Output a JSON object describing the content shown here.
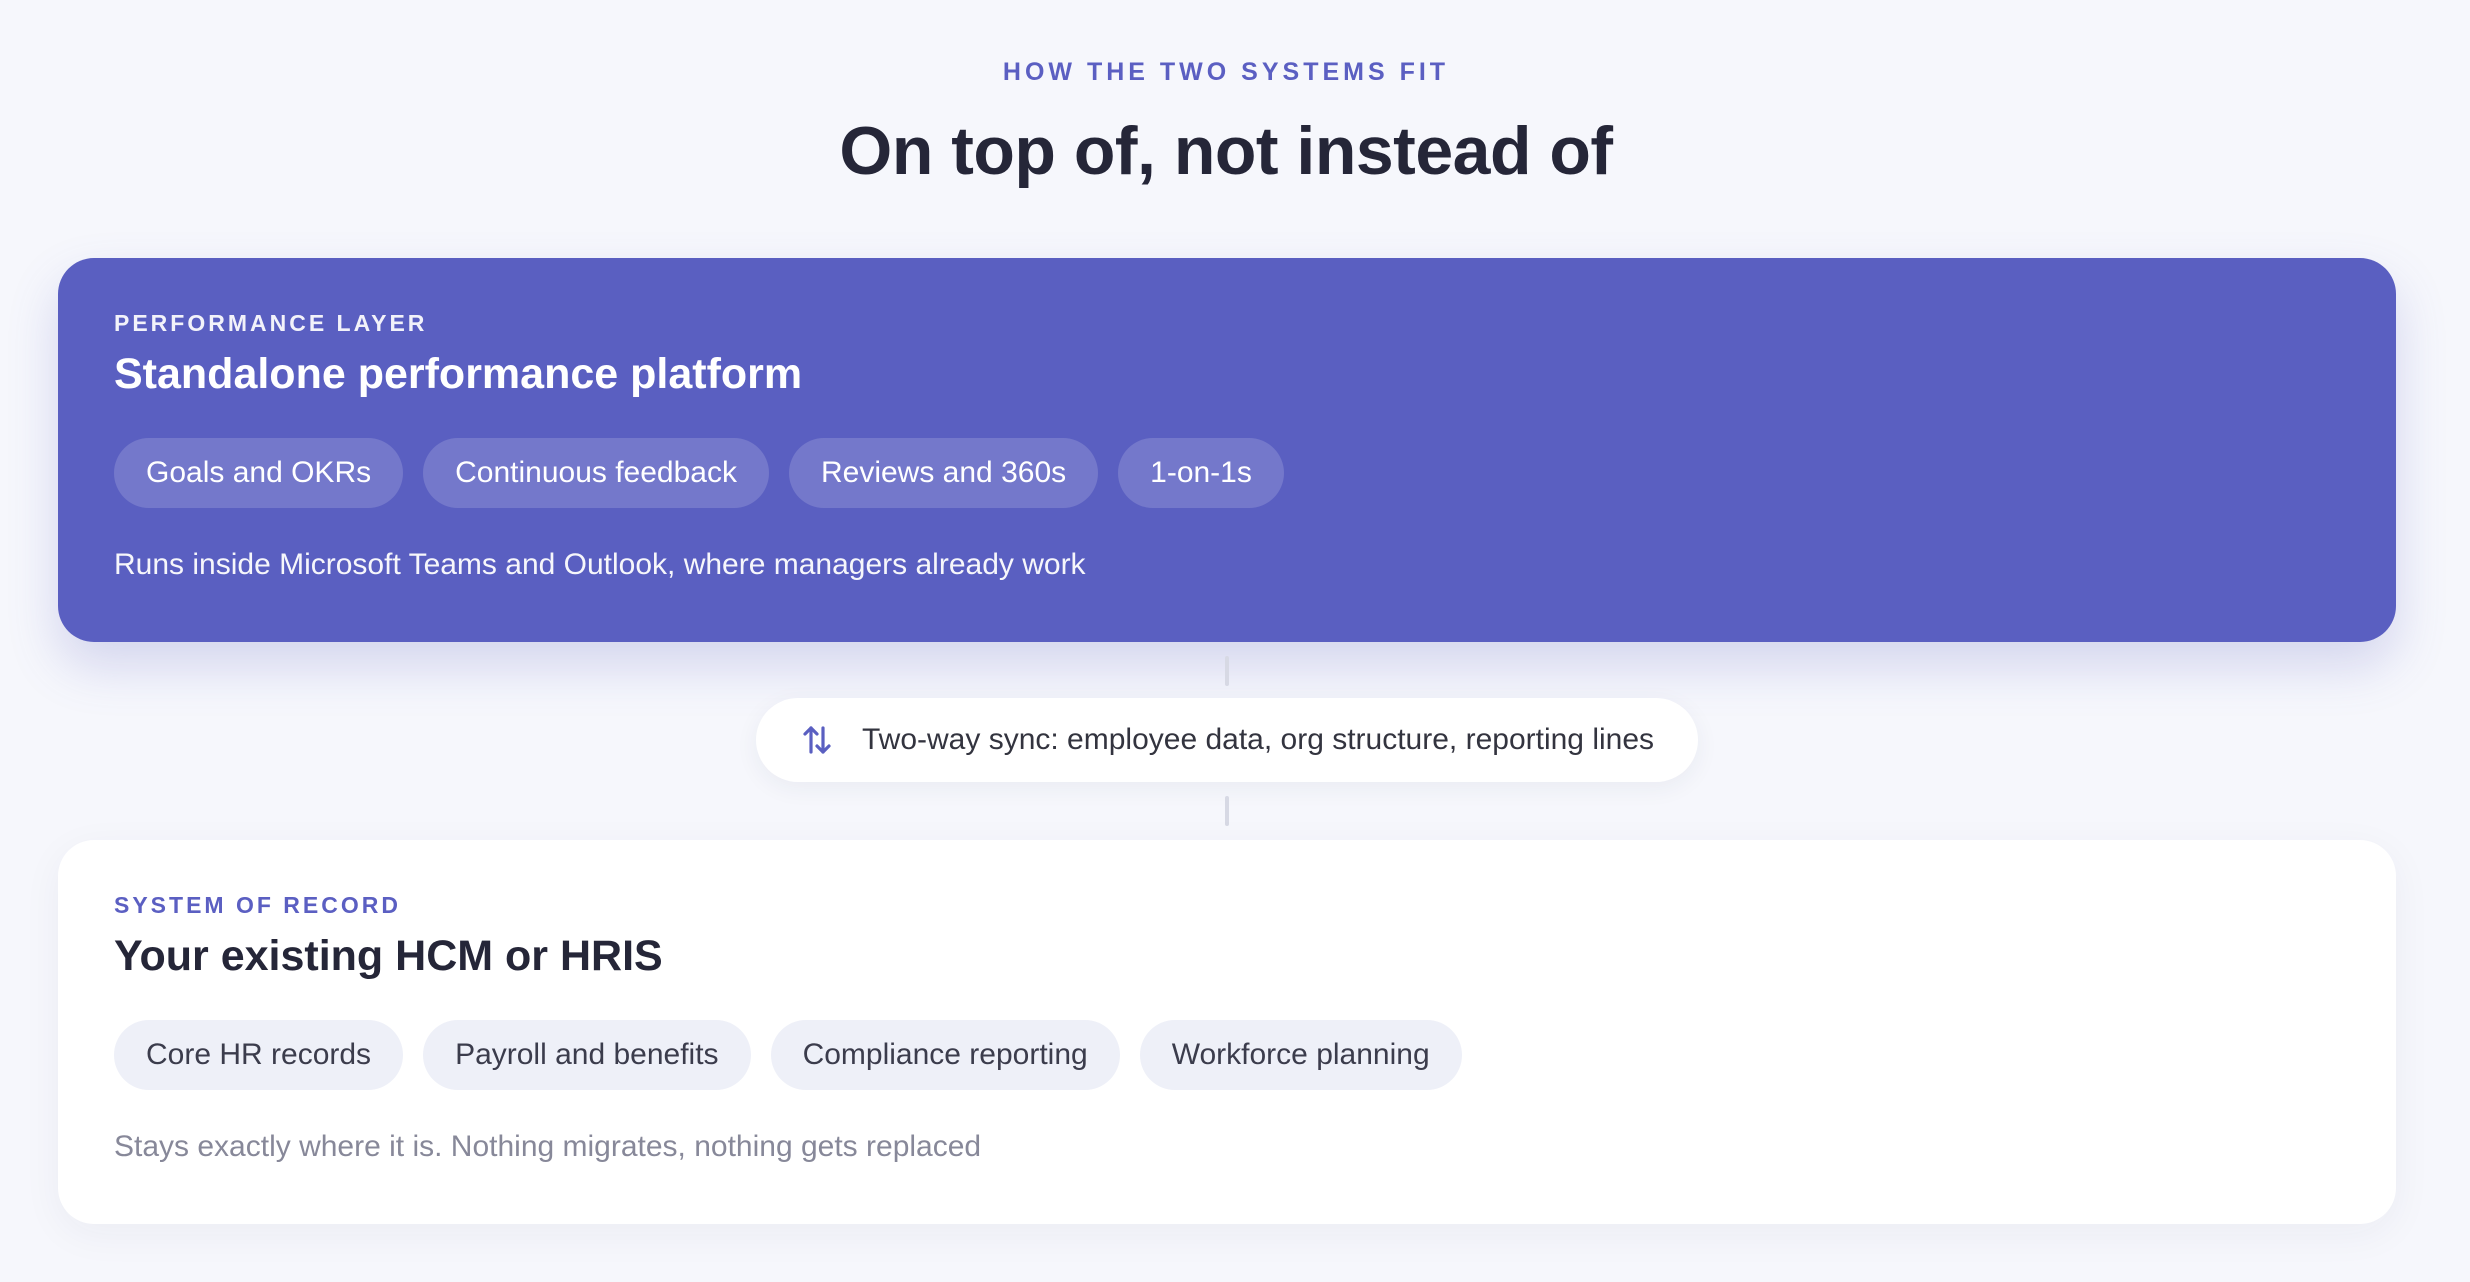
{
  "header": {
    "eyebrow": "HOW THE TWO SYSTEMS FIT",
    "title": "On top of, not instead of"
  },
  "performance_layer": {
    "kicker": "PERFORMANCE LAYER",
    "title": "Standalone performance platform",
    "chips": [
      "Goals and OKRs",
      "Continuous feedback",
      "Reviews and 360s",
      "1-on-1s"
    ],
    "note": "Runs inside Microsoft Teams and Outlook, where managers already work"
  },
  "sync": {
    "icon": "sync-arrows-icon",
    "label": "Two-way sync: employee data, org structure, reporting lines"
  },
  "system_of_record": {
    "kicker": "SYSTEM OF RECORD",
    "title": "Your existing HCM or HRIS",
    "chips": [
      "Core HR records",
      "Payroll and benefits",
      "Compliance reporting",
      "Workforce planning"
    ],
    "note": "Stays exactly where it is. Nothing migrates, nothing gets replaced"
  },
  "colors": {
    "accent": "#5a5fc1",
    "heading": "#252638",
    "background": "#f6f7fc"
  }
}
